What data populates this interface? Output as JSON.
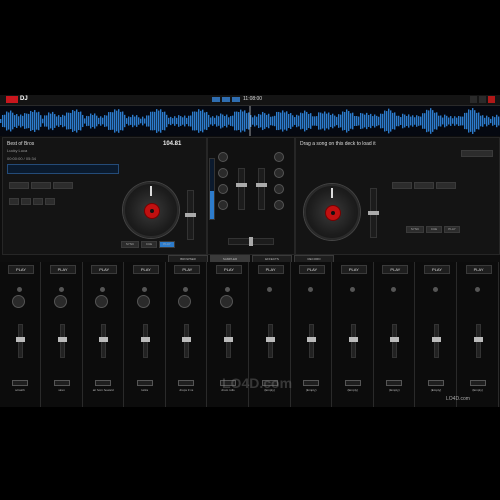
{
  "app": {
    "logo_text": "DJ"
  },
  "titlebar": {
    "clock": "11:08:00"
  },
  "deck_left": {
    "title": "Best of Bros",
    "artist": "Lucky Luca",
    "bpm": "104.81",
    "info1": "00:00:00 / 05:34",
    "buttons": [
      "SYNC",
      "CUE",
      "PLAY"
    ]
  },
  "deck_right": {
    "title": "Drag a song on this deck to load it",
    "sub": "",
    "bpm": "",
    "buttons": [
      "SYNC",
      "CUE",
      "PLAY"
    ]
  },
  "tabs": [
    "BROWSER",
    "SAMPLER",
    "EFFECTS",
    "RECORD"
  ],
  "sampler": {
    "slots": [
      {
        "play": "PLAY",
        "name": "scratch"
      },
      {
        "play": "PLAY",
        "name": "siren"
      },
      {
        "play": "PLAY",
        "name": "air horn howard"
      },
      {
        "play": "PLAY",
        "name": "kicks"
      },
      {
        "play": "PLAY",
        "name": "drops 3 vs"
      },
      {
        "play": "PLAY",
        "name": "drum rolls"
      },
      {
        "play": "PLAY",
        "name": "(Empty)"
      },
      {
        "play": "PLAY",
        "name": "(Empty)"
      },
      {
        "play": "PLAY",
        "name": "(Empty)"
      },
      {
        "play": "PLAY",
        "name": "(Empty)"
      },
      {
        "play": "PLAY",
        "name": "(Empty)"
      },
      {
        "play": "PLAY",
        "name": "(Empty)"
      }
    ]
  },
  "watermark": "LO4D.com",
  "footer_watermark": "LO4D.com",
  "colors": {
    "accent": "#2d7ccc",
    "platter_center": "#c01010",
    "close": "#b01818"
  }
}
